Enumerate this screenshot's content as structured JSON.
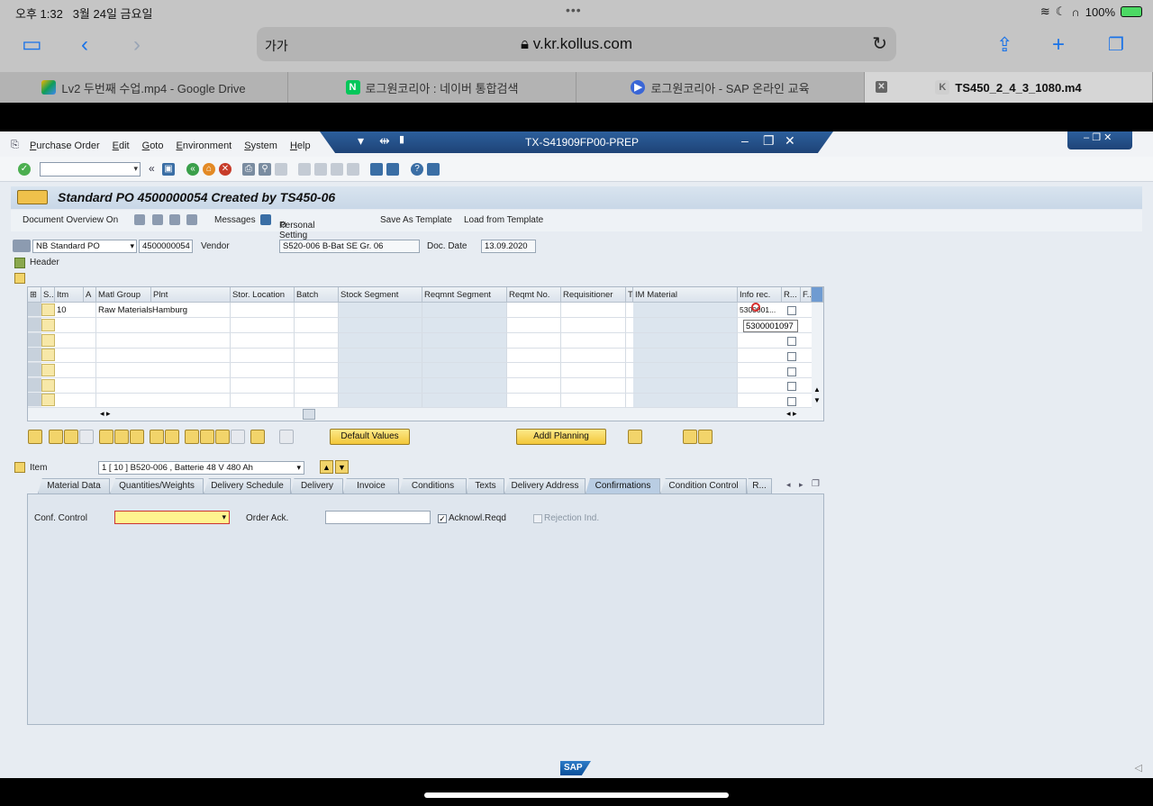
{
  "ios": {
    "time": "오후 1:32",
    "date": "3월 24일 금요일",
    "battery": "100%"
  },
  "safari": {
    "aa_label": "가가",
    "url": "v.kr.kollus.com",
    "tabs": [
      {
        "label": "Lv2 두번째 수업.mp4 - Google Drive"
      },
      {
        "label": "로그원코리아 : 네이버 통합검색"
      },
      {
        "label": "로그원코리아 - SAP 온라인 교육"
      },
      {
        "label": "TS450_2_4_3_1080.m4"
      }
    ]
  },
  "sap": {
    "menu": [
      "Purchase Order",
      "Edit",
      "Goto",
      "Environment",
      "System",
      "Help"
    ],
    "window_title": "TX-S41909FP00-PREP",
    "page_title": "Standard PO 4500000054 Created by TS450-06",
    "app_toolbar": {
      "document_overview": "Document Overview On",
      "messages": "Messages",
      "personal_setting": "Personal Setting",
      "save_template": "Save As Template",
      "load_template": "Load from Template"
    },
    "header": {
      "po_type": "NB Standard PO",
      "po_number": "4500000054",
      "vendor_label": "Vendor",
      "vendor_value": "S520-006 B-Bat SE Gr. 06",
      "doc_date_label": "Doc. Date",
      "doc_date_value": "13.09.2020",
      "header_label": "Header"
    },
    "table": {
      "columns": [
        "S..",
        "Itm",
        "A",
        "Matl Group",
        "Plnt",
        "Stor. Location",
        "Batch",
        "Stock Segment",
        "Reqmnt Segment",
        "Reqmt No.",
        "Requisitioner",
        "T",
        "IM Material",
        "Info rec.",
        "R...",
        "F..."
      ],
      "row1": {
        "itm": "10",
        "matl_group": "Raw Materials",
        "plant": "Hamburg",
        "info_rec": "5300001..."
      },
      "tooltip": "5300001097"
    },
    "buttons": {
      "default_values": "Default Values",
      "addl_planning": "Addl Planning"
    },
    "item": {
      "label": "Item",
      "value": "1 [ 10 ] B520-006 , Batterie 48 V 480 Ah"
    },
    "tabs": [
      "Material Data",
      "Quantities/Weights",
      "Delivery Schedule",
      "Delivery",
      "Invoice",
      "Conditions",
      "Texts",
      "Delivery Address",
      "Confirmations",
      "Condition Control",
      "R..."
    ],
    "confirmations": {
      "conf_control_label": "Conf. Control",
      "conf_control_value": "",
      "order_ack_label": "Order Ack.",
      "order_ack_value": "",
      "acknowl_label": "Acknowl.Reqd",
      "rejection_label": "Rejection Ind."
    },
    "brand": "SAP"
  }
}
